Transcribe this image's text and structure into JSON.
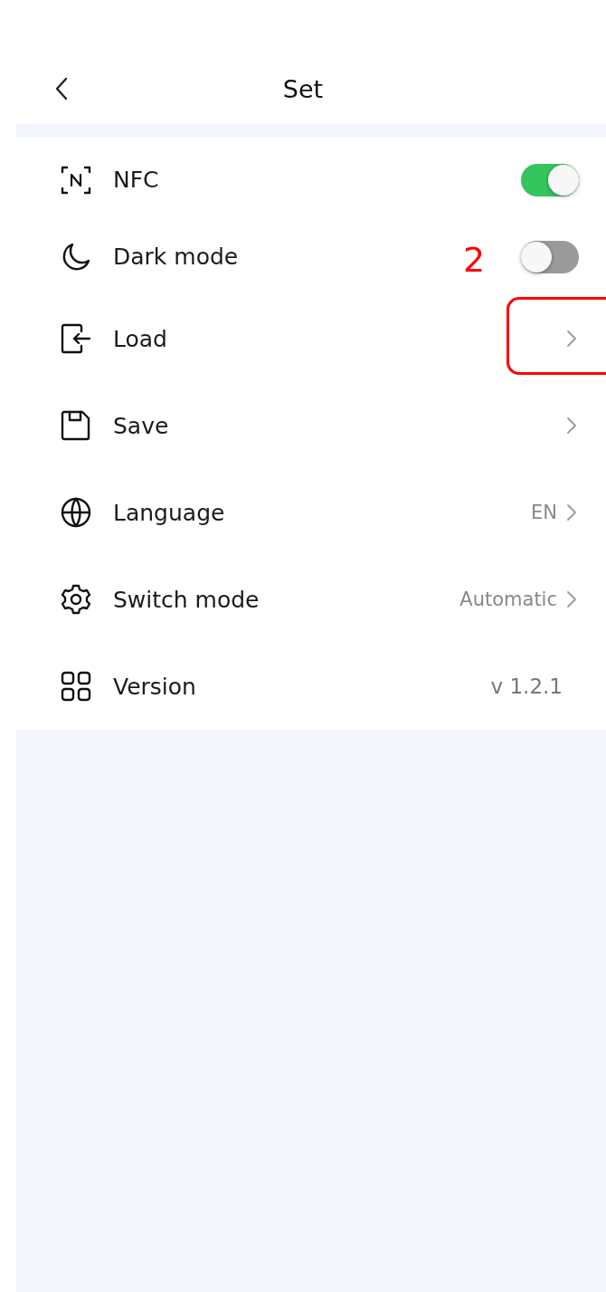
{
  "header": {
    "title": "Set"
  },
  "settings": [
    {
      "kind": "toggle",
      "label": "NFC",
      "on": true
    },
    {
      "kind": "toggle",
      "label": "Dark mode",
      "on": false
    },
    {
      "kind": "link",
      "label": "Load"
    },
    {
      "kind": "link",
      "label": "Save"
    },
    {
      "kind": "link",
      "label": "Language",
      "value": "EN"
    },
    {
      "kind": "link",
      "label": "Switch mode",
      "value": "Automatic"
    },
    {
      "kind": "info",
      "label": "Version",
      "value": "v 1.2.1"
    }
  ],
  "annotation": {
    "label": "2"
  }
}
